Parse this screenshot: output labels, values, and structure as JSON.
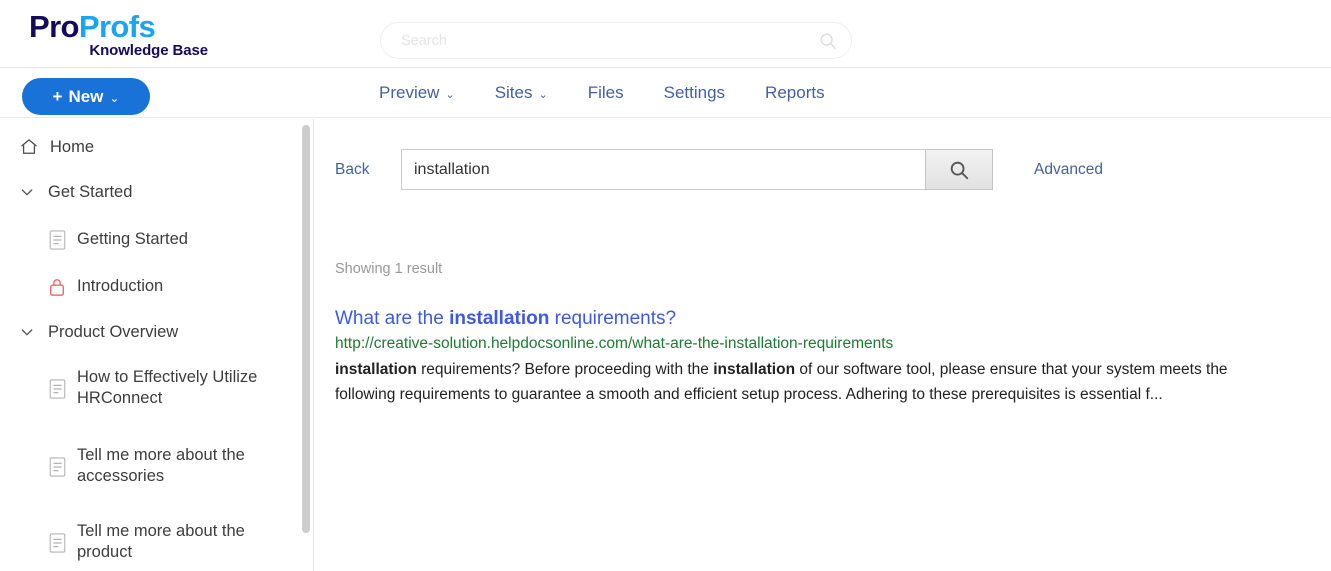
{
  "header": {
    "logo": {
      "part1": "Pro",
      "part2": "Profs",
      "subtitle": "Knowledge Base",
      "color1": "#150a5c",
      "color2": "#1ba5f0"
    },
    "global_search": {
      "placeholder": "Search",
      "value": "",
      "icon": "search-icon"
    }
  },
  "toolbar": {
    "new_button": {
      "label": "New",
      "plus": "+",
      "chevron": "⌄",
      "color": "#1872d8"
    },
    "nav": [
      {
        "label": "Preview",
        "has_chevron": true,
        "chevron": "⌄"
      },
      {
        "label": "Sites",
        "has_chevron": true,
        "chevron": "⌄"
      },
      {
        "label": "Files",
        "has_chevron": false,
        "chevron": ""
      },
      {
        "label": "Settings",
        "has_chevron": false,
        "chevron": ""
      },
      {
        "label": "Reports",
        "has_chevron": false,
        "chevron": ""
      }
    ],
    "nav_color": "#45619d"
  },
  "sidebar": {
    "items": [
      {
        "label": "Home",
        "icon": "home-icon"
      },
      {
        "label": "Get Started",
        "icon": "chevron-down-icon"
      },
      {
        "label": "Getting Started",
        "icon": "document-icon"
      },
      {
        "label": "Introduction",
        "icon": "lock-icon"
      },
      {
        "label": "Product Overview",
        "icon": "chevron-down-icon"
      },
      {
        "label": "How to Effectively Utilize HRConnect",
        "icon": "document-icon"
      },
      {
        "label": "Tell me more about the accessories",
        "icon": "document-icon"
      },
      {
        "label": "Tell me more about the product",
        "icon": "document-icon"
      }
    ],
    "lock_color": "#f4696b",
    "scrollbar": {
      "thumb_color": "#cdcdcd"
    }
  },
  "search_panel": {
    "back_label": "Back",
    "query": "installation",
    "placeholder": "",
    "search_button_icon": "search-icon",
    "advanced_label": "Advanced"
  },
  "results": {
    "showing": "Showing 1 result",
    "items": [
      {
        "title_pre": "What are the ",
        "title_highlight": "installation",
        "title_post": " requirements?",
        "url": "http://creative-solution.helpdocsonline.com/what-are-the-installation-requirements",
        "snippet_1": "installation",
        "snippet_2": " requirements? Before proceeding with the ",
        "snippet_3": "installation",
        "snippet_4": " of our software tool, please ensure that your system meets the following requirements to guarantee a smooth and efficient setup process. Adhering to these prerequisites is essential f...",
        "title_color": "#3d5ae0",
        "url_color": "#1f7a33"
      }
    ]
  }
}
